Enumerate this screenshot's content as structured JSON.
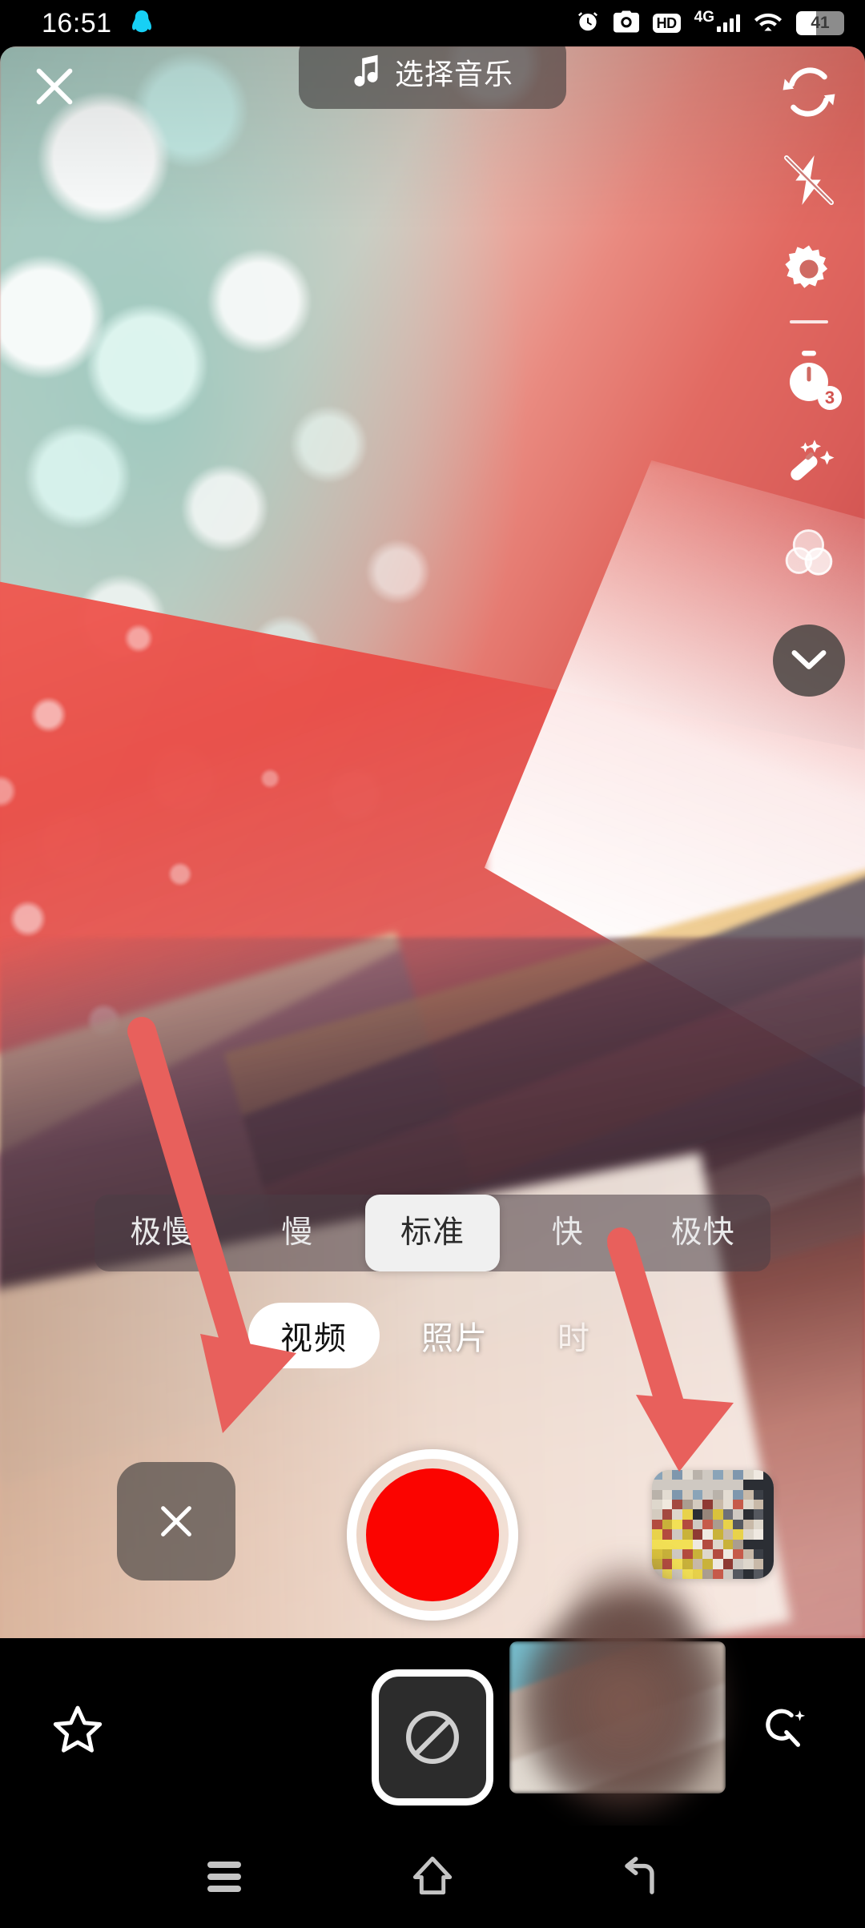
{
  "status_bar": {
    "time": "16:51",
    "qq_icon": "penguin-icon",
    "icons": [
      "alarm-clock-icon",
      "camera-icon",
      "hd-badge",
      "4g-signal",
      "wifi-icon"
    ],
    "hd_label": "HD",
    "network_label": "4G",
    "battery_percent": "41"
  },
  "camera": {
    "close_label": "×",
    "music_button": {
      "icon": "music-note-icon",
      "label": "选择音乐"
    },
    "rail": [
      {
        "name": "flip-camera-icon",
        "label": ""
      },
      {
        "name": "flash-off-icon",
        "label": ""
      },
      {
        "name": "settings-gear-icon",
        "label": ""
      },
      {
        "name": "timer-icon",
        "badge": "3"
      },
      {
        "name": "beauty-wand-icon",
        "label": ""
      },
      {
        "name": "filters-icon",
        "label": ""
      },
      {
        "name": "chevron-down-icon",
        "label": ""
      }
    ],
    "speed": {
      "options": [
        "极慢",
        "慢",
        "标准",
        "快",
        "极快"
      ],
      "selected": "标准"
    },
    "modes": {
      "options": [
        "视频",
        "照片",
        "时"
      ],
      "selected": "视频"
    },
    "capture": {
      "delete_label": "×",
      "record_label": "",
      "gallery_label": ""
    }
  },
  "bottom_bar": {
    "star_icon": "star-outline-icon",
    "center_icon": "no-entry-icon",
    "search_icon": "search-sparkle-icon"
  },
  "nav_bar": {
    "menu_icon": "menu-icon",
    "home_icon": "home-icon",
    "back_icon": "back-icon"
  },
  "annotations": {
    "arrow_color": "#e8605c",
    "arrows": [
      {
        "name": "arrow-to-record-button"
      },
      {
        "name": "arrow-to-gallery-thumbnail"
      }
    ]
  },
  "colors": {
    "record_red": "#fb0400",
    "accent_arrow": "#e8605c",
    "bar_bg": "rgba(74,62,70,0.55)",
    "status_bg": "#000000"
  }
}
